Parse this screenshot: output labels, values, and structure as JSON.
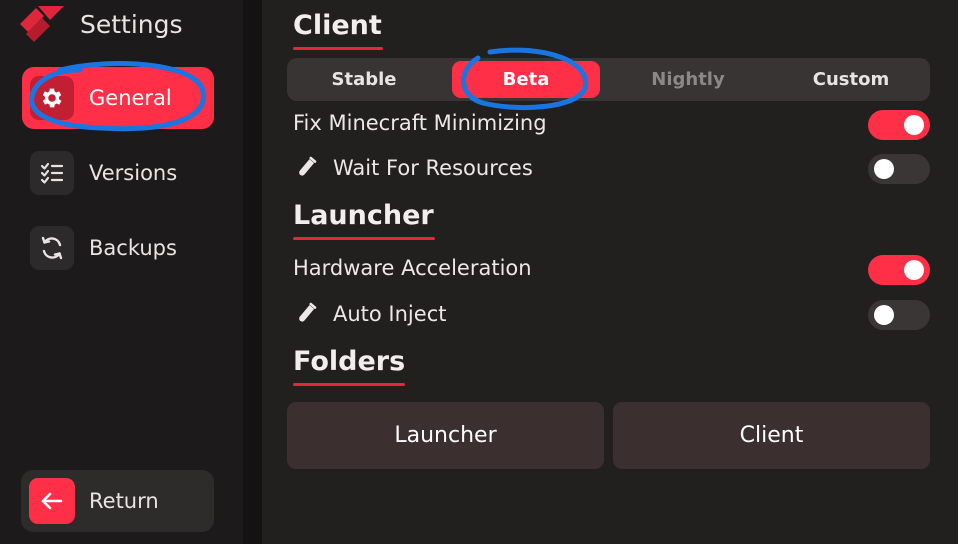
{
  "sidebar": {
    "title": "Settings",
    "items": [
      {
        "label": "General",
        "icon": "gear-icon",
        "active": true
      },
      {
        "label": "Versions",
        "icon": "checklist-icon",
        "active": false
      },
      {
        "label": "Backups",
        "icon": "refresh-icon",
        "active": false
      }
    ],
    "return_label": "Return"
  },
  "client": {
    "title": "Client",
    "channels": [
      {
        "label": "Stable",
        "state": "normal"
      },
      {
        "label": "Beta",
        "state": "active"
      },
      {
        "label": "Nightly",
        "state": "dim"
      },
      {
        "label": "Custom",
        "state": "normal"
      }
    ],
    "settings": [
      {
        "label": "Fix Minecraft Minimizing",
        "enabled": true,
        "beta_icon": false
      },
      {
        "label": "Wait For Resources",
        "enabled": false,
        "beta_icon": true
      }
    ]
  },
  "launcher": {
    "title": "Launcher",
    "settings": [
      {
        "label": "Hardware Acceleration",
        "enabled": true,
        "beta_icon": false
      },
      {
        "label": "Auto Inject",
        "enabled": false,
        "beta_icon": true
      }
    ]
  },
  "folders": {
    "title": "Folders",
    "buttons": [
      "Launcher",
      "Client"
    ]
  },
  "colors": {
    "accent": "#ff2f48",
    "annotation": "#1976e0"
  }
}
